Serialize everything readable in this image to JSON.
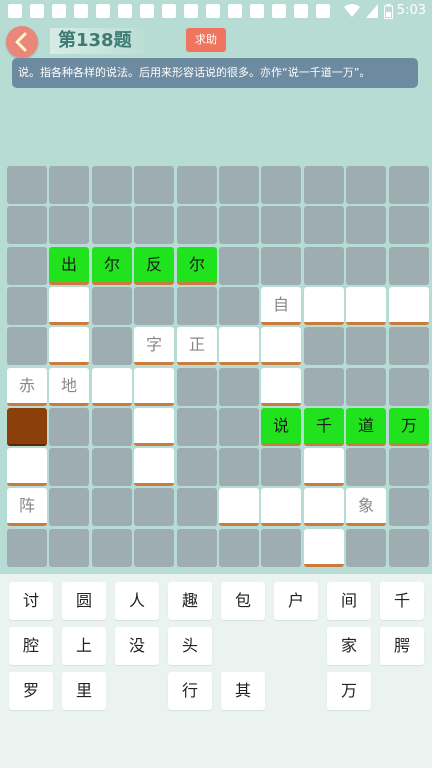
{
  "status": {
    "time": "5:03"
  },
  "header": {
    "title": "第138题",
    "help_label": "求助"
  },
  "clue": "说。指各种各样的说法。后用来形容话说的很多。亦作“说一千道一万”。",
  "grid": {
    "rows": [
      [
        {
          "t": "e"
        },
        {
          "t": "e"
        },
        {
          "t": "e"
        },
        {
          "t": "e"
        },
        {
          "t": "e"
        },
        {
          "t": "e"
        },
        {
          "t": "e"
        },
        {
          "t": "e"
        },
        {
          "t": "e"
        },
        {
          "t": "e"
        }
      ],
      [
        {
          "t": "e"
        },
        {
          "t": "e"
        },
        {
          "t": "e"
        },
        {
          "t": "e"
        },
        {
          "t": "e"
        },
        {
          "t": "e"
        },
        {
          "t": "e"
        },
        {
          "t": "e"
        },
        {
          "t": "e"
        },
        {
          "t": "e"
        }
      ],
      [
        {
          "t": "e"
        },
        {
          "t": "g",
          "c": "出"
        },
        {
          "t": "g",
          "c": "尔"
        },
        {
          "t": "g",
          "c": "反"
        },
        {
          "t": "g",
          "c": "尔"
        },
        {
          "t": "e"
        },
        {
          "t": "e"
        },
        {
          "t": "e"
        },
        {
          "t": "e"
        },
        {
          "t": "e"
        }
      ],
      [
        {
          "t": "e"
        },
        {
          "t": "w",
          "c": ""
        },
        {
          "t": "e"
        },
        {
          "t": "e"
        },
        {
          "t": "e"
        },
        {
          "t": "e"
        },
        {
          "t": "w",
          "c": "自"
        },
        {
          "t": "w",
          "c": ""
        },
        {
          "t": "w",
          "c": ""
        },
        {
          "t": "w",
          "c": ""
        }
      ],
      [
        {
          "t": "e"
        },
        {
          "t": "w",
          "c": ""
        },
        {
          "t": "e"
        },
        {
          "t": "w",
          "c": "字"
        },
        {
          "t": "w",
          "c": "正"
        },
        {
          "t": "w",
          "c": ""
        },
        {
          "t": "w",
          "c": ""
        },
        {
          "t": "e"
        },
        {
          "t": "e"
        },
        {
          "t": "e"
        }
      ],
      [
        {
          "t": "w",
          "c": "赤"
        },
        {
          "t": "w",
          "c": "地"
        },
        {
          "t": "w",
          "c": ""
        },
        {
          "t": "w",
          "c": ""
        },
        {
          "t": "e"
        },
        {
          "t": "e"
        },
        {
          "t": "w",
          "c": ""
        },
        {
          "t": "e"
        },
        {
          "t": "e"
        },
        {
          "t": "e"
        }
      ],
      [
        {
          "t": "b"
        },
        {
          "t": "e"
        },
        {
          "t": "e"
        },
        {
          "t": "w",
          "c": ""
        },
        {
          "t": "e"
        },
        {
          "t": "e"
        },
        {
          "t": "g",
          "c": "说"
        },
        {
          "t": "g",
          "c": "千"
        },
        {
          "t": "g",
          "c": "道"
        },
        {
          "t": "g",
          "c": "万"
        }
      ],
      [
        {
          "t": "w",
          "c": ""
        },
        {
          "t": "e"
        },
        {
          "t": "e"
        },
        {
          "t": "w",
          "c": ""
        },
        {
          "t": "e"
        },
        {
          "t": "e"
        },
        {
          "t": "e"
        },
        {
          "t": "w",
          "c": ""
        },
        {
          "t": "e"
        },
        {
          "t": "e"
        }
      ],
      [
        {
          "t": "w",
          "c": "阵"
        },
        {
          "t": "e"
        },
        {
          "t": "e"
        },
        {
          "t": "e"
        },
        {
          "t": "e"
        },
        {
          "t": "w",
          "c": ""
        },
        {
          "t": "w",
          "c": ""
        },
        {
          "t": "w",
          "c": ""
        },
        {
          "t": "w",
          "c": "象"
        },
        {
          "t": "e"
        }
      ],
      [
        {
          "t": "e"
        },
        {
          "t": "e"
        },
        {
          "t": "e"
        },
        {
          "t": "e"
        },
        {
          "t": "e"
        },
        {
          "t": "e"
        },
        {
          "t": "e"
        },
        {
          "t": "w",
          "c": ""
        },
        {
          "t": "e"
        },
        {
          "t": "e"
        }
      ]
    ]
  },
  "keyboard": {
    "rows": [
      [
        "讨",
        "圆",
        "人",
        "趣",
        "包",
        "户",
        "间",
        "千"
      ],
      [
        "腔",
        "上",
        "没",
        "头",
        "",
        "",
        "家",
        "腭"
      ],
      [
        "罗",
        "里",
        "",
        "行",
        "其",
        "",
        "万",
        ""
      ]
    ]
  }
}
